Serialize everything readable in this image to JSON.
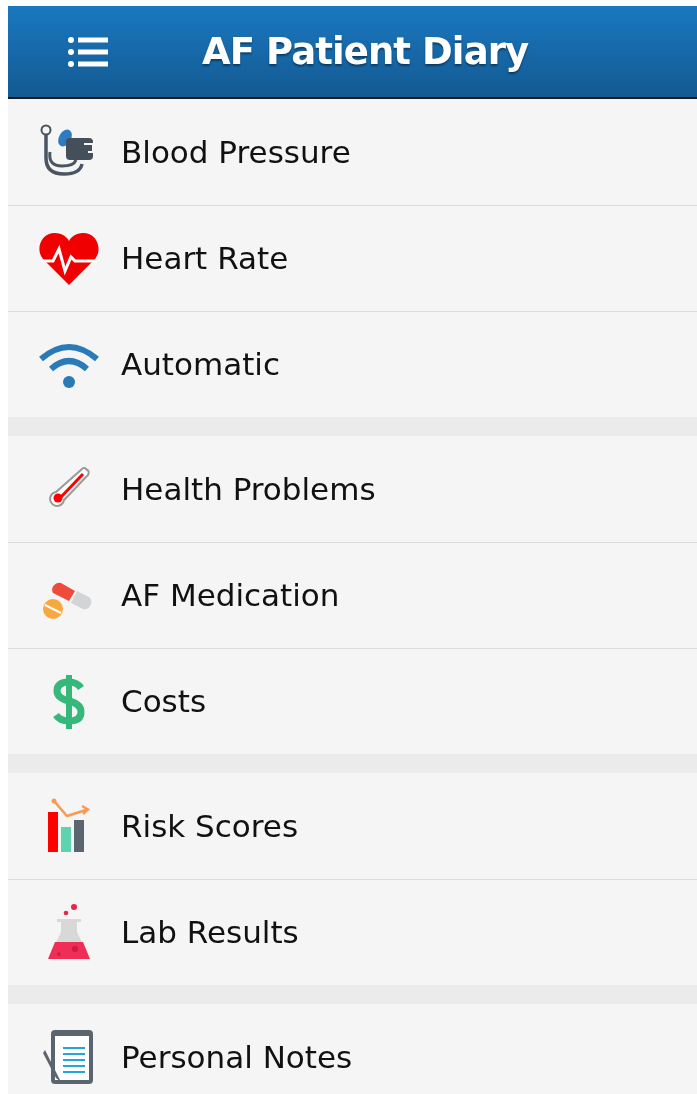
{
  "header": {
    "title": "AF Patient Diary"
  },
  "groups": [
    {
      "items": [
        {
          "label": "Blood Pressure"
        },
        {
          "label": "Heart Rate"
        },
        {
          "label": "Automatic"
        }
      ]
    },
    {
      "items": [
        {
          "label": "Health Problems"
        },
        {
          "label": "AF Medication"
        },
        {
          "label": "Costs"
        }
      ]
    },
    {
      "items": [
        {
          "label": "Risk Scores"
        },
        {
          "label": "Lab Results"
        }
      ]
    },
    {
      "items": [
        {
          "label": "Personal Notes"
        }
      ]
    }
  ]
}
